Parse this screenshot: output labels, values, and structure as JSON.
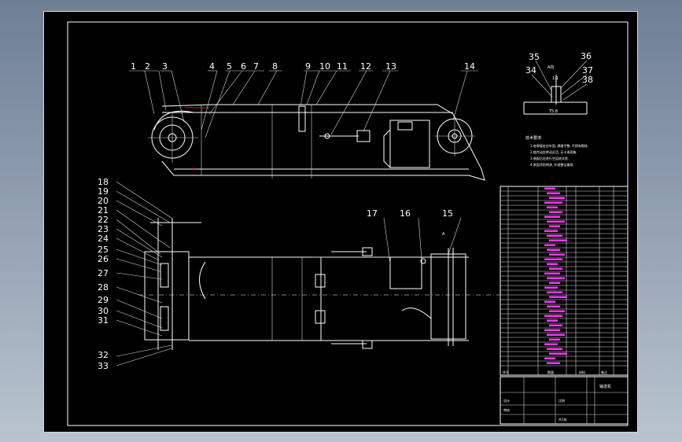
{
  "drawing": {
    "part_numbers": [
      "1",
      "2",
      "3",
      "4",
      "5",
      "6",
      "7",
      "8",
      "9",
      "10",
      "11",
      "12",
      "13",
      "14",
      "15",
      "16",
      "17",
      "18",
      "19",
      "20",
      "21",
      "22",
      "23",
      "24",
      "25",
      "26",
      "27",
      "28",
      "29",
      "30",
      "31",
      "32",
      "33",
      "34",
      "35",
      "36",
      "37",
      "38"
    ],
    "detail_view": {
      "title": "A向",
      "scale": "1:1",
      "base_label": "T5.8"
    },
    "view_marker": "A",
    "notes_title": "技术要求:",
    "notes": [
      "1.各焊接处应牢固, 焊缝平整, 不得有裂纹.",
      "2.链传动应转动灵活, 无卡滞现象.",
      "3.装配后应进行空运转试验.",
      "4.表面涂防锈漆, 外观整洁美观."
    ],
    "title_block": {
      "name": "输送机",
      "material_col": "材料",
      "qty_col": "数量",
      "seq_col": "序号",
      "remark_col": "备注",
      "scale_col": "比例",
      "sheet": "共1张",
      "design": "设计",
      "check": "审核"
    }
  },
  "colors": {
    "background": "#000000",
    "lines": "#ffffff",
    "highlight": "#ff33ff",
    "accent": "#ff3030"
  }
}
